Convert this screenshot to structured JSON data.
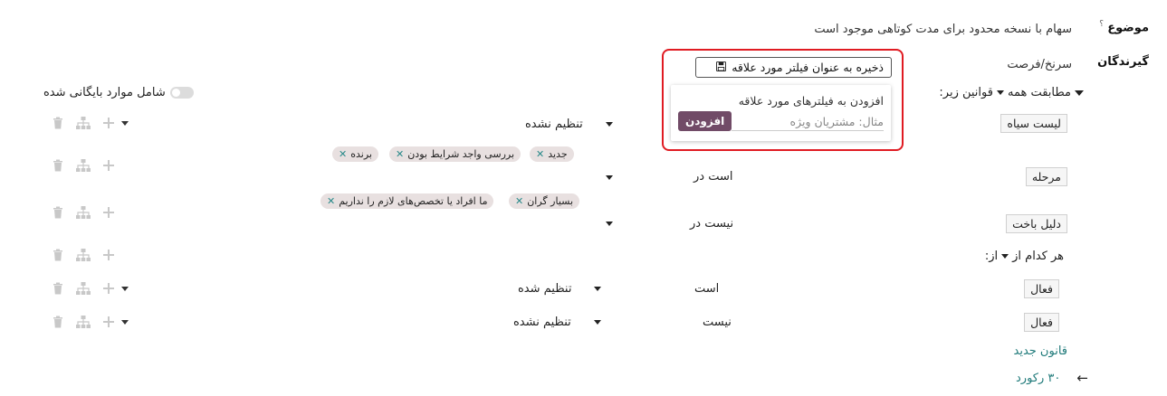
{
  "subject": {
    "label": "موضوع",
    "help": "؟",
    "value": "سهام با نسخه محدود برای مدت کوتاهی موجود است"
  },
  "recipients": {
    "label": "گیرندگان",
    "value": "سرنخ/فرصت"
  },
  "save_filter": {
    "label": "ذخیره به عنوان فیلتر مورد علاقه",
    "icon": "floppy-disk-icon"
  },
  "popup": {
    "title": "افزودن به فیلترهای مورد علاقه",
    "placeholder": "مثال: مشتریان ویژه",
    "add_button": "افزودن"
  },
  "include_archived": "شامل موارد بایگانی شده",
  "match_all": {
    "text": "مطابقت همه",
    "suffix": "قوانین زیر:"
  },
  "rules": [
    {
      "field": "لیست سیاه",
      "value": "تنظیم نشده"
    },
    {
      "field": "مرحله",
      "operator": "است در",
      "tags": [
        "جدید",
        "بررسی واجد شرایط بودن",
        "برنده"
      ]
    },
    {
      "field": "دلیل باخت",
      "operator": "نیست در",
      "tags": [
        "بسیار گران",
        "ما افراد یا تخصص‌های لازم را نداریم"
      ]
    }
  ],
  "any_of": {
    "text": "هر کدام از",
    "suffix": "از:"
  },
  "sub_rules": [
    {
      "field": "فعال",
      "operator": "است",
      "value": "تنظیم شده"
    },
    {
      "field": "فعال",
      "operator": "نیست",
      "value": "تنظیم نشده"
    }
  ],
  "new_rule": "قانون جدید",
  "records": {
    "count": "۳۰ رکورد",
    "arrow": "←"
  },
  "colors": {
    "brand": "#714b67",
    "teal": "#1f7a7a",
    "highlight": "#e01b22"
  }
}
